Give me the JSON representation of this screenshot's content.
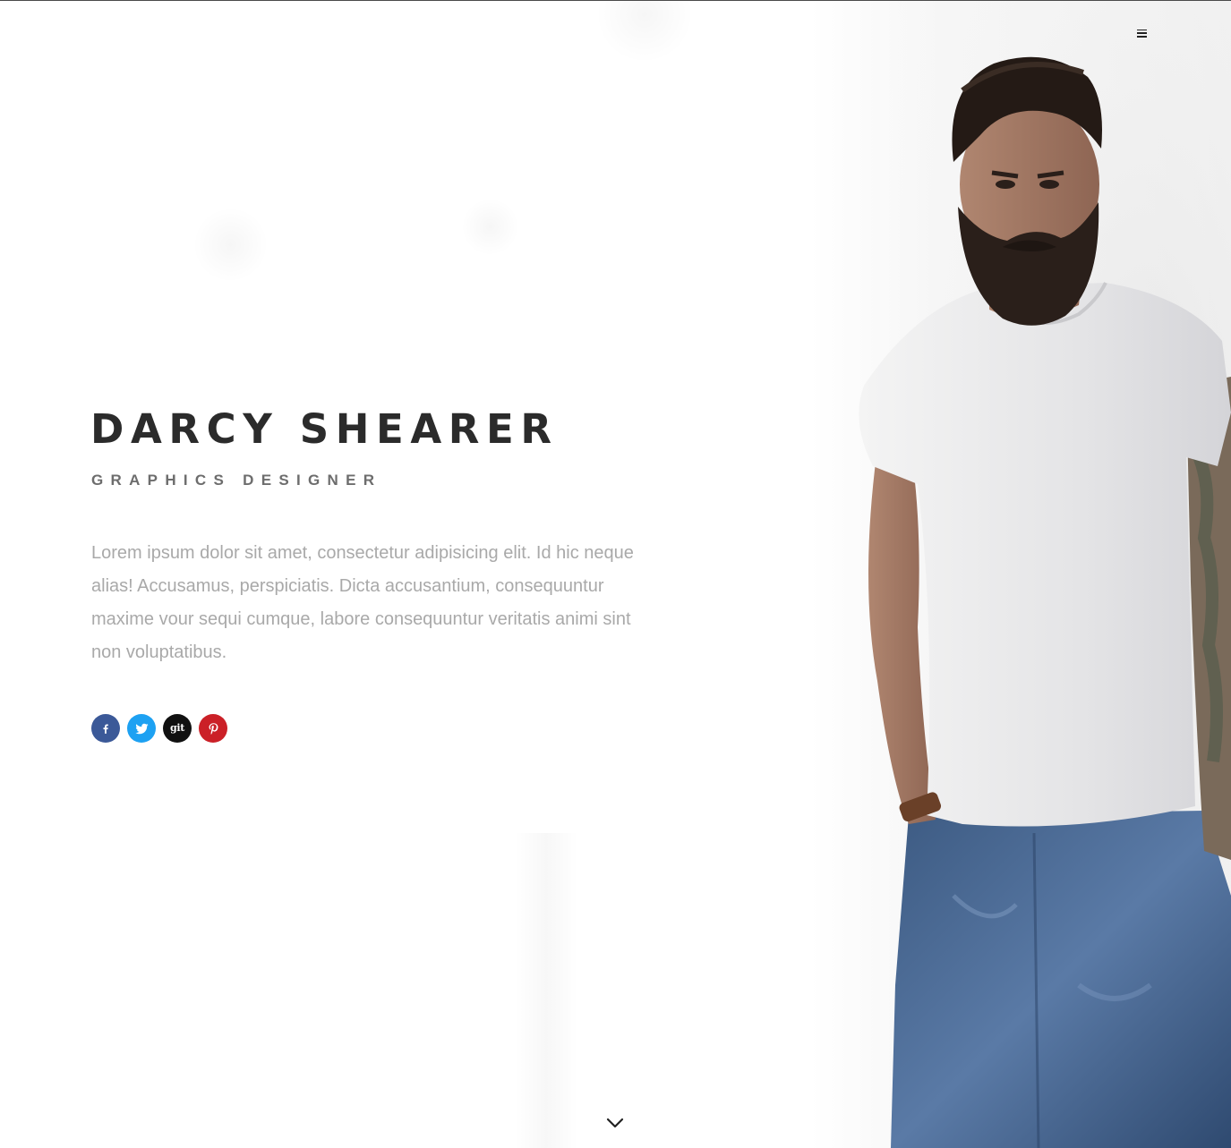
{
  "nav": {
    "menu_icon": "hamburger-icon"
  },
  "hero": {
    "name": "DARCY SHEARER",
    "role": "GRAPHICS DESIGNER",
    "bio": "Lorem ipsum dolor sit amet, consectetur adipisicing elit. Id hic neque alias! Accusamus, perspiciatis. Dicta accusantium, consequuntur maxime vour sequi cumque, labore consequuntur veritatis animi sint non voluptatibus.",
    "scroll_icon": "chevron-down-icon"
  },
  "social": [
    {
      "name": "facebook",
      "icon": "facebook-icon",
      "color": "#3b5998"
    },
    {
      "name": "twitter",
      "icon": "twitter-icon",
      "color": "#1da1f2"
    },
    {
      "name": "github",
      "icon": "github-icon",
      "label": "git",
      "color": "#111111"
    },
    {
      "name": "pinterest",
      "icon": "pinterest-icon",
      "color": "#cb2027"
    }
  ],
  "photo": {
    "subject": "portrait-photo"
  }
}
